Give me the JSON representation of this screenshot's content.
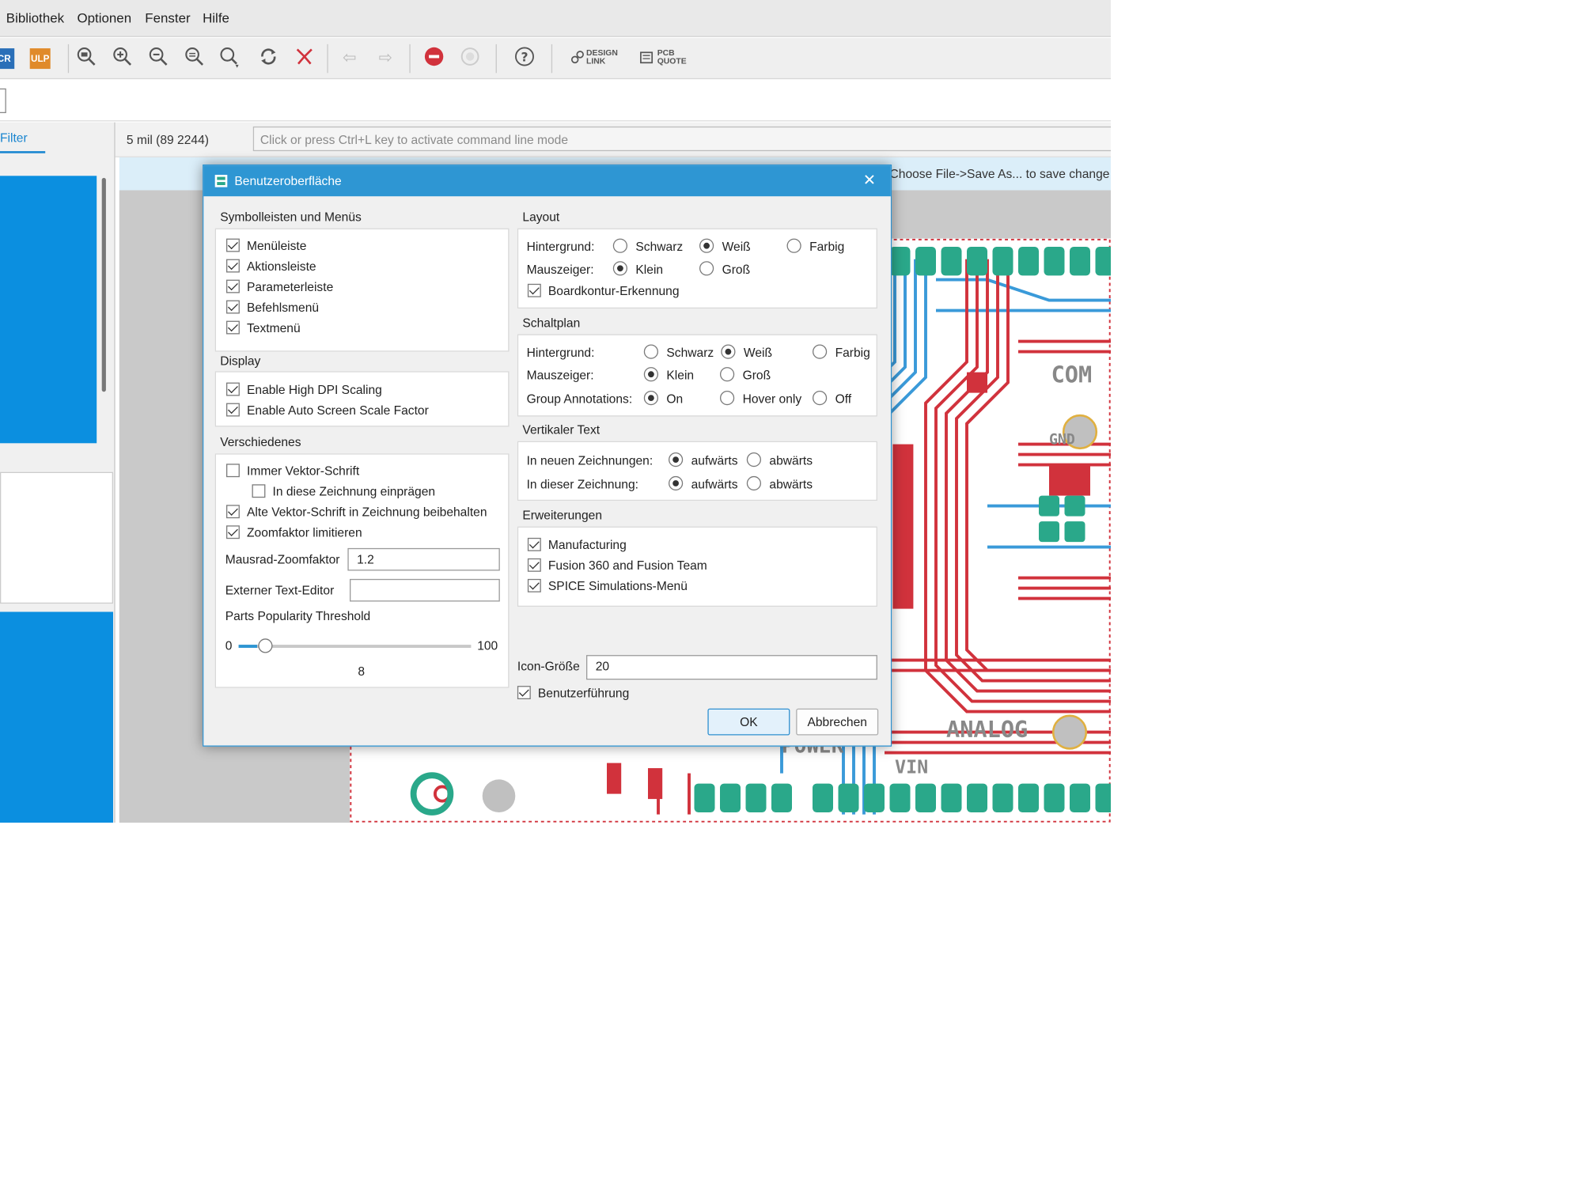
{
  "menu": {
    "items": [
      "Bibliothek",
      "Optionen",
      "Fenster",
      "Hilfe"
    ]
  },
  "toolbar": {
    "scr_label": "CR",
    "ulp_label": "ULP",
    "design_link_line1": "DESIGN",
    "design_link_line2": "LINK",
    "pcb_quote_line1": "PCB",
    "pcb_quote_line2": "QUOTE",
    "icons": [
      "scr-icon",
      "ulp-icon",
      "zoom-select-icon",
      "zoom-in-icon",
      "zoom-out-icon",
      "zoom-fit-icon",
      "zoom-area-icon",
      "redraw-icon",
      "ripup-icon",
      "undo-icon",
      "redo-icon",
      "stop-icon",
      "go-icon",
      "help-icon",
      "design-link-icon",
      "pcb-quote-icon"
    ]
  },
  "left_panel": {
    "filter_label": "Filter"
  },
  "status": {
    "coordinate": "5 mil (89 2244)",
    "cmd_placeholder": "Click or press Ctrl+L key to activate command line mode",
    "info": "Choose File->Save As... to save change"
  },
  "dialog": {
    "title": "Benutzeroberfläche",
    "close": "✕",
    "toolbars": {
      "heading": "Symbolleisten und Menüs",
      "items": [
        {
          "label": "Menüleiste",
          "checked": true
        },
        {
          "label": "Aktionsleiste",
          "checked": true
        },
        {
          "label": "Parameterleiste",
          "checked": true
        },
        {
          "label": "Befehlsmenü",
          "checked": true
        },
        {
          "label": "Textmenü",
          "checked": true
        }
      ]
    },
    "display": {
      "heading": "Display",
      "items": [
        {
          "label": "Enable High DPI Scaling",
          "checked": true
        },
        {
          "label": "Enable Auto Screen Scale Factor",
          "checked": true
        }
      ]
    },
    "misc": {
      "heading": "Verschiedenes",
      "vector_font": {
        "label": "Immer Vektor-Schrift",
        "checked": false
      },
      "embed": {
        "label": "In diese Zeichnung einprägen",
        "checked": false
      },
      "keep_font": {
        "label": "Alte Vektor-Schrift in Zeichnung beibehalten",
        "checked": true
      },
      "limit_zoom": {
        "label": "Zoomfaktor limitieren",
        "checked": true
      },
      "wheel_zoom_label": "Mausrad-Zoomfaktor",
      "wheel_zoom_value": "1.2",
      "editor_label": "Externer Text-Editor",
      "editor_value": "",
      "threshold_label": "Parts Popularity Threshold",
      "slider_min": "0",
      "slider_max": "100",
      "slider_value": "8",
      "slider_fraction": 0.08
    },
    "layout": {
      "heading": "Layout",
      "bg_label": "Hintergrund:",
      "bg_options": [
        {
          "label": "Schwarz",
          "selected": false
        },
        {
          "label": "Weiß",
          "selected": true
        },
        {
          "label": "Farbig",
          "selected": false
        }
      ],
      "cursor_label": "Mauszeiger:",
      "cursor_options": [
        {
          "label": "Klein",
          "selected": true
        },
        {
          "label": "Groß",
          "selected": false
        }
      ],
      "board_outline": {
        "label": "Boardkontur-Erkennung",
        "checked": true
      }
    },
    "schematic": {
      "heading": "Schaltplan",
      "bg_label": "Hintergrund:",
      "bg_options": [
        {
          "label": "Schwarz",
          "selected": false
        },
        {
          "label": "Weiß",
          "selected": true
        },
        {
          "label": "Farbig",
          "selected": false
        }
      ],
      "cursor_label": "Mauszeiger:",
      "cursor_options": [
        {
          "label": "Klein",
          "selected": true
        },
        {
          "label": "Groß",
          "selected": false
        }
      ],
      "annotations_label": "Group Annotations:",
      "annotation_options": [
        {
          "label": "On",
          "selected": true
        },
        {
          "label": "Hover only",
          "selected": false
        },
        {
          "label": "Off",
          "selected": false
        }
      ]
    },
    "vertical_text": {
      "heading": "Vertikaler Text",
      "new_label": "In neuen Zeichnungen:",
      "this_label": "In dieser Zeichnung:",
      "up": "aufwärts",
      "down": "abwärts",
      "new_selected": "up",
      "this_selected": "up"
    },
    "extensions": {
      "heading": "Erweiterungen",
      "items": [
        {
          "label": "Manufacturing",
          "checked": true
        },
        {
          "label": "Fusion 360 and Fusion Team",
          "checked": true
        },
        {
          "label": "SPICE Simulations-Menü",
          "checked": true
        }
      ]
    },
    "icon_size_label": "Icon-Größe",
    "icon_size_value": "20",
    "guidance": {
      "label": "Benutzerführung",
      "checked": true
    },
    "ok_label": "OK",
    "cancel_label": "Abbrechen"
  },
  "colors": {
    "accent": "#2e96d3",
    "trace_red": "#d1323c",
    "trace_blue": "#3a9ad9",
    "pad_green": "#2aa88a",
    "panel_blue": "#0b8fe0"
  },
  "board": {
    "labels": [
      "COM",
      "GND",
      "ANALOG",
      "POWER",
      "VIN"
    ]
  }
}
